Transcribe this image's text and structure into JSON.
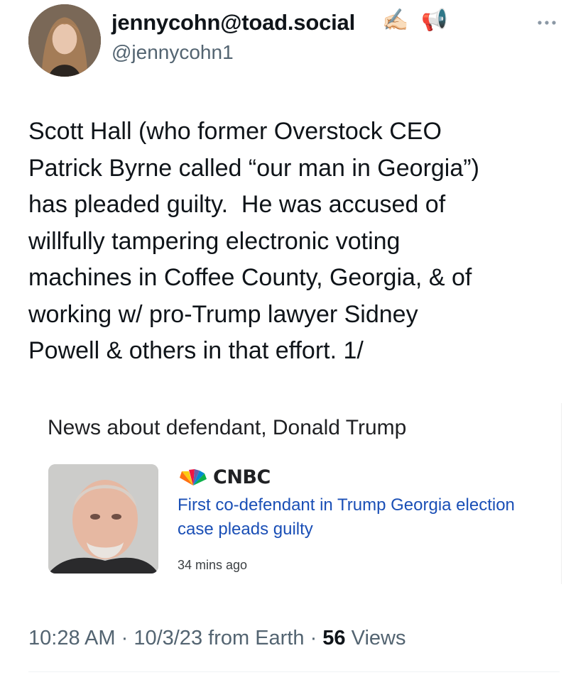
{
  "author": {
    "display_name": "jennycohn@toad.social",
    "name_emojis": [
      "✍🏻",
      "📢"
    ],
    "handle": "@jennycohn1",
    "avatar_icon": "profile-photo"
  },
  "more_icon": "more-horizontal-icon",
  "tweet": {
    "text": "Scott Hall (who former Overstock CEO\nPatrick Byrne called “our man in Georgia”)\nhas pleaded guilty.  He was accused of\nwillfully tampering electronic voting\nmachines in Coffee County, Georgia, & of\nworking w/ pro-Trump lawyer Sidney\nPowell & others in that effort. 1/"
  },
  "card": {
    "title": "News about defendant, Donald Trump",
    "source_icon": "nbc-peacock-icon",
    "source_name": "CNBC",
    "headline": "First co-defendant in Trump Georgia election case pleads guilty",
    "time_ago": "34 mins ago"
  },
  "meta": {
    "time": "10:28 AM",
    "separator": " · ",
    "date": "10/3/23",
    "from": " from Earth",
    "views_count": "56",
    "views_label": " Views"
  },
  "colors": {
    "text": "#0f1419",
    "secondary": "#536471",
    "link_blue": "#1a4fb6"
  }
}
